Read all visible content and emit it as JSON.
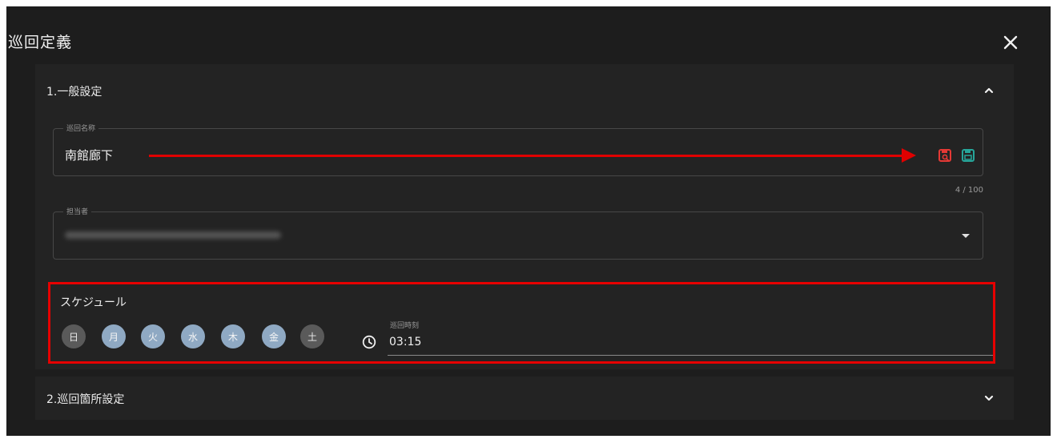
{
  "dialog": {
    "title": "巡回定義"
  },
  "section1": {
    "header": "1.一般設定",
    "patrol_name": {
      "label": "巡回名称",
      "value": "南館廊下",
      "counter": "4 / 100"
    },
    "assignee": {
      "label": "担当者"
    }
  },
  "schedule": {
    "title": "スケジュール",
    "days": [
      {
        "label": "日",
        "selected": false
      },
      {
        "label": "月",
        "selected": true
      },
      {
        "label": "火",
        "selected": true
      },
      {
        "label": "水",
        "selected": true
      },
      {
        "label": "木",
        "selected": true
      },
      {
        "label": "金",
        "selected": true
      },
      {
        "label": "土",
        "selected": false
      }
    ],
    "time_label": "巡回時刻",
    "time_value": "03:15"
  },
  "section2": {
    "header": "2.巡回箇所設定"
  },
  "colors": {
    "background": "#1d1d1d",
    "panel": "#232323",
    "day_selected": "#8fa9c3",
    "day_unselected": "#5a5a5a",
    "highlight_red": "#e60000",
    "icon_red": "#e53935",
    "icon_green": "#26a69a"
  },
  "icons": [
    "close-icon",
    "chevron-up-icon",
    "chevron-down-icon",
    "search-save-icon",
    "save-icon",
    "dropdown-arrow-icon",
    "clock-icon"
  ]
}
